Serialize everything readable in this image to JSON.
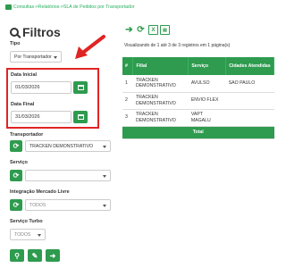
{
  "breadcrumb": {
    "text": "Consultas->Relatórios->SLA de Pedidos por Transportador"
  },
  "filters": {
    "title": "Filtros",
    "tipo": {
      "label": "Tipo",
      "value": "Por Transportador"
    },
    "data_inicial": {
      "label": "Data Inicial",
      "value": "01/03/2026"
    },
    "data_final": {
      "label": "Data Final",
      "value": "31/03/2026"
    },
    "transportador": {
      "label": "Transportador",
      "value": "TRACKEN DEMONSTRATIVO"
    },
    "servico": {
      "label": "Serviço",
      "value": ""
    },
    "integracao": {
      "label": "Integração Mercado Livre",
      "value": "TODOS"
    },
    "servico_turbo": {
      "label": "Serviço Turbo",
      "value": "TODOS"
    }
  },
  "results": {
    "records_text": "Visualizando de 1 até 3 de 3 registros em 1 página(s)",
    "headers": [
      "#",
      "Filial",
      "Serviço",
      "Cidades Atendidas"
    ],
    "rows": [
      [
        "1",
        "TRACKEN DEMONSTRATIVO",
        "AVULSO",
        "SAO PAULO"
      ],
      [
        "2",
        "TRACKEN DEMONSTRATIVO",
        "ENVIO FLEX",
        ""
      ],
      [
        "3",
        "TRACKEN DEMONSTRATIVO",
        "VAPT MAGALU",
        ""
      ]
    ],
    "total_label": "Total"
  },
  "colors": {
    "accent": "#2e9b4f",
    "highlight": "#e02424",
    "link": "#27ae60"
  }
}
